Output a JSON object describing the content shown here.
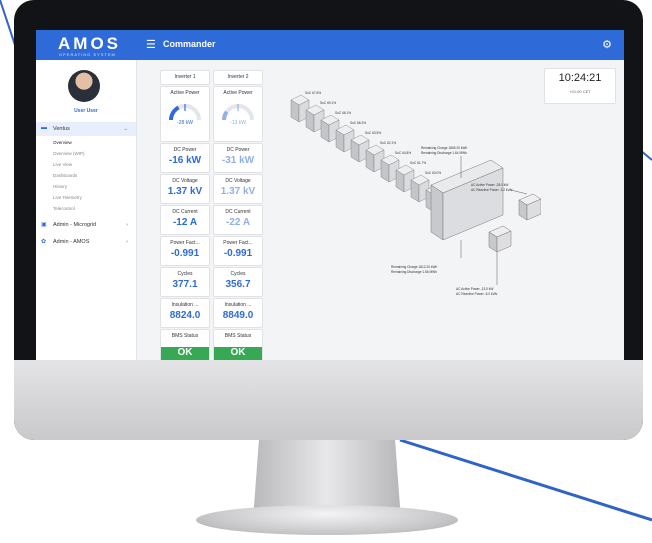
{
  "app": {
    "logo": "AMOS",
    "logo_subtitle": "OPERATING SYSTEM",
    "title": "Commander",
    "menu_icon": "hamburger-icon",
    "settings_icon": "gear-icon"
  },
  "user": {
    "name": "User User"
  },
  "sidebar": {
    "groups": [
      {
        "label": "Ventus",
        "icon": "grid-icon",
        "expanded": true
      },
      {
        "label": "Admin - Microgrid",
        "icon": "building-icon",
        "expanded": false
      },
      {
        "label": "Admin - AMOS",
        "icon": "gear-icon",
        "expanded": false
      }
    ],
    "sub_items": [
      "Overview",
      "Overview (WIP)",
      "Live View",
      "Dashboards",
      "History",
      "Live Telemetry",
      "Telecontrol"
    ]
  },
  "inverters": [
    {
      "header": "Inverter 1",
      "active_power_title": "Active Power",
      "active_power": "-28 kW",
      "gauge_fraction": 0.35,
      "dc_power_title": "DC Power",
      "dc_power": "-16 kW",
      "dc_voltage_title": "DC Voltage",
      "dc_voltage": "1.37 kV",
      "dc_current_title": "DC Current",
      "dc_current": "-12 A",
      "power_factor_title": "Power Fact...",
      "power_factor": "-0.991",
      "cycles_title": "Cycles",
      "cycles": "377.1",
      "insulation_title": "Insulation ...",
      "insulation": "8824.0",
      "bms_title": "BMS Status",
      "bms": "OK"
    },
    {
      "header": "Inverter 2",
      "active_power_title": "Active Power",
      "active_power": "-13 kW",
      "gauge_fraction": 0.2,
      "dc_power_title": "DC Power",
      "dc_power": "-31 kW",
      "dc_voltage_title": "DC Voltage",
      "dc_voltage": "1.37 kV",
      "dc_current_title": "DC Current",
      "dc_current": "-22 A",
      "power_factor_title": "Power Fact...",
      "power_factor": "-0.991",
      "cycles_title": "Cycles",
      "cycles": "356.7",
      "insulation_title": "Insulation ...",
      "insulation": "8849.0",
      "bms_title": "BMS Status",
      "bms": "OK"
    }
  ],
  "clock": {
    "time": "10:24:21",
    "zone": "+01:00 CET"
  },
  "diagram": {
    "module_labels": [
      "SoC 67.6%",
      "SoC 69.1%",
      "SoC 66.1%",
      "SoC 66.3%",
      "SoC 63.5%",
      "SoC 62.1%",
      "SoC 64.8%",
      "SoC 61.7%",
      "SoC 63.0%",
      "SoC 66.3%"
    ],
    "remaining_charge_1": "Remaining Charge 1865.20 kWh",
    "remaining_discharge_1": "Remaining Discharge 1.64 MWh",
    "remaining_charge_2": "Remaining Charge 1812.20 kWh",
    "remaining_discharge_2": "Remaining Discharge 1.66 MWh",
    "ac_active_power_1": "AC Active Power -28.0 kW",
    "ac_reactive_power_1": "AC Reactive Power -3.2 kVAr",
    "ac_active_power_2": "AC Active Power -13.0 kW",
    "ac_reactive_power_2": "AC Reactive Power -6.0 kVAr"
  },
  "colors": {
    "accent": "#2f6bd8",
    "ok": "#37a853",
    "topbar": "#2f6bd8"
  }
}
